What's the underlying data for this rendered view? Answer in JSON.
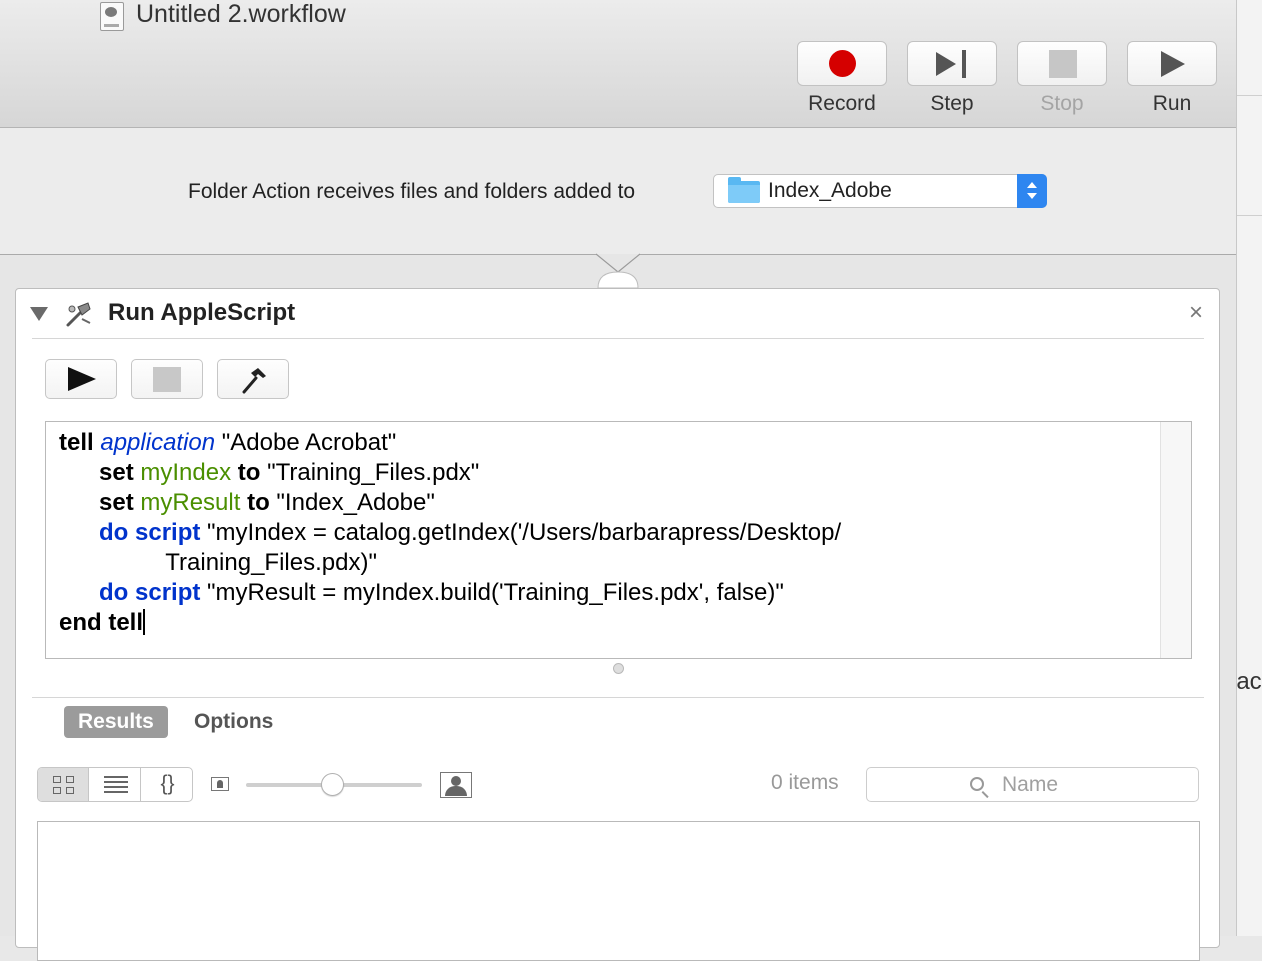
{
  "window": {
    "title": "Untitled 2.workflow"
  },
  "toolbar": {
    "record_label": "Record",
    "step_label": "Step",
    "stop_label": "Stop",
    "run_label": "Run"
  },
  "workflow_input": {
    "label": "Folder Action receives files and folders added to",
    "folder": "Index_Adobe"
  },
  "action": {
    "title": "Run AppleScript",
    "close": "×",
    "script_lines": {
      "l1_tell": "tell",
      "l1_app": "application",
      "l1_str": " \"Adobe Acrobat\"",
      "l2_set": "set",
      "l2_var": "myIndex",
      "l2_to": "to",
      "l2_str": " \"Training_Files.pdx\"",
      "l3_set": "set",
      "l3_var": "myResult",
      "l3_to": "to",
      "l3_str": " \"Index_Adobe\"",
      "l4_do": "do script",
      "l4_str": " \"myIndex = catalog.getIndex('/Users/barbarapress/Desktop/",
      "l5_str": "Training_Files.pdx)\"",
      "l6_do": "do script",
      "l6_str": " \"myResult = myIndex.build('Training_Files.pdx', false)\"",
      "l7_end": "end tell"
    },
    "tabs": {
      "results": "Results",
      "options": "Options"
    },
    "view_json_label": "{}",
    "items_count": "0 items",
    "search_placeholder": "Name"
  },
  "sidebar_fragment": {
    "text": "lac"
  }
}
